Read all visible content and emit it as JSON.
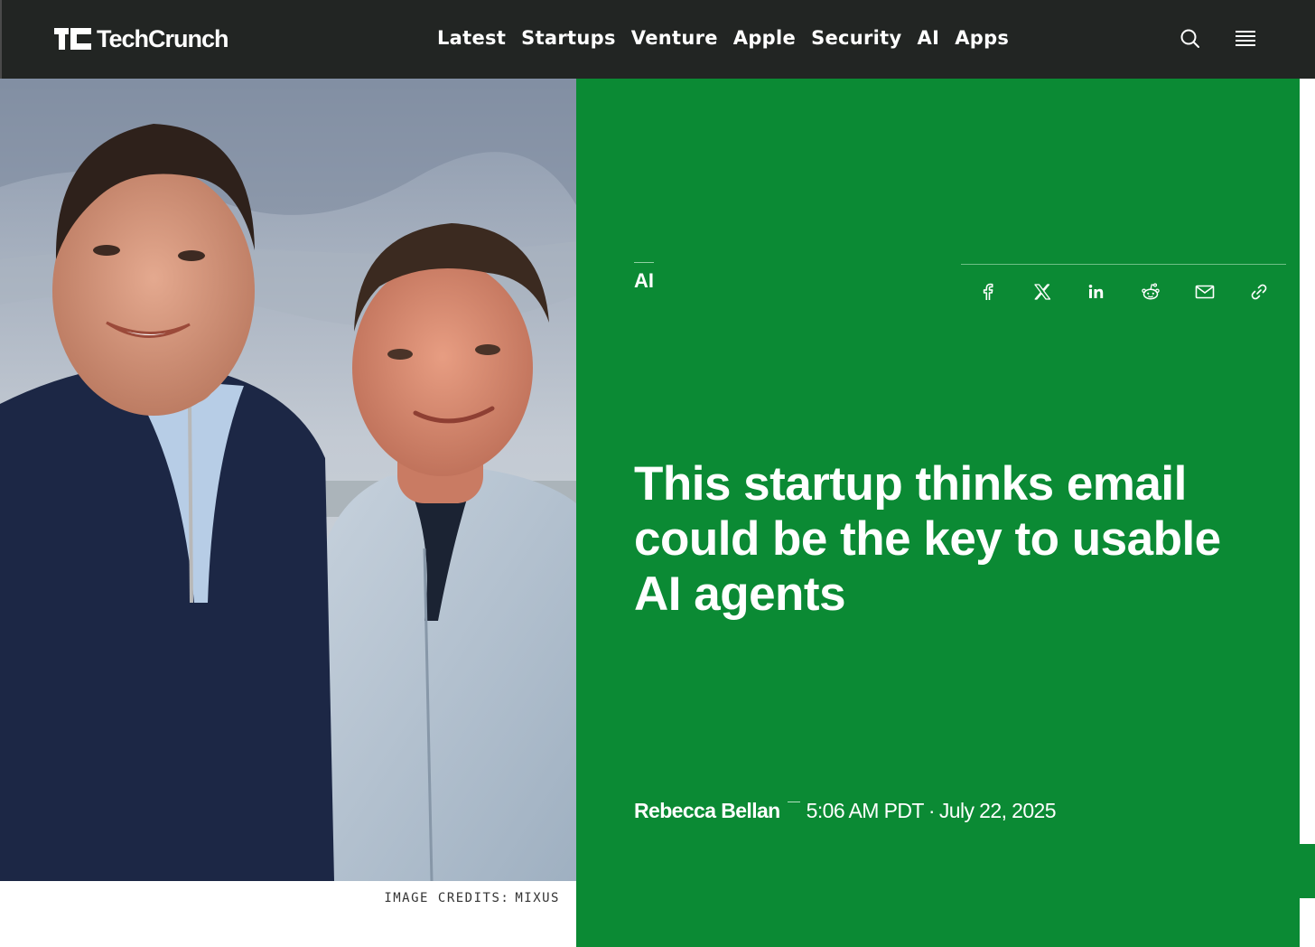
{
  "header": {
    "logo_text": "TechCrunch",
    "nav": [
      "Latest",
      "Startups",
      "Venture",
      "Apple",
      "Security",
      "AI",
      "Apps"
    ],
    "search_icon": "search-icon",
    "menu_icon": "hamburger-menu-icon"
  },
  "hero": {
    "image": "two-founders-portrait",
    "credits_label": "IMAGE CREDITS:",
    "credits_value": "MIXUS"
  },
  "article": {
    "category": "AI",
    "headline": "This startup thinks email could be the key to usable AI agents",
    "author": "Rebecca Bellan",
    "time": "5:06 AM PDT",
    "separator": "·",
    "date": "July 22, 2025"
  },
  "share": [
    {
      "icon": "facebook-icon"
    },
    {
      "icon": "x-icon"
    },
    {
      "icon": "linkedin-icon"
    },
    {
      "icon": "reddit-icon"
    },
    {
      "icon": "email-icon"
    },
    {
      "icon": "link-icon"
    }
  ],
  "colors": {
    "header_bg": "#222523",
    "panel_green": "#0b8a34",
    "text_white": "#ffffff"
  }
}
